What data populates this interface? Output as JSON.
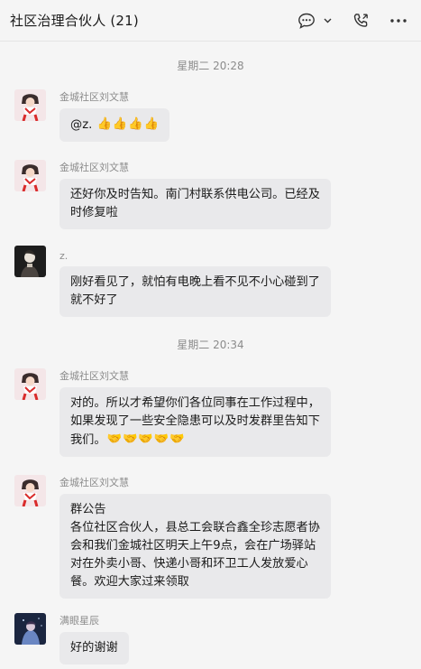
{
  "header": {
    "title": "社区治理合伙人 (21)",
    "icons": [
      "chat-bubble-icon",
      "chevron-down-icon",
      "phone-icon",
      "more-dots-icon"
    ]
  },
  "times": [
    "星期二 20:28",
    "星期二 20:34"
  ],
  "messages": [
    {
      "sender": "金城社区刘文慧",
      "lines": [
        "@z. "
      ],
      "emoji": [
        "👍",
        "👍",
        "👍",
        "👍"
      ]
    },
    {
      "sender": "金城社区刘文慧",
      "lines": [
        "还好你及时告知。南门村联系供电公司。已经及",
        "时修复啦"
      ]
    },
    {
      "sender": "z.",
      "lines": [
        "刚好看见了，就怕有电晚上看不见不小心碰到了",
        "就不好了"
      ]
    },
    {
      "sender": "金城社区刘文慧",
      "lines": [
        "对的。所以才希望你们各位同事在工作过程中，",
        "如果发现了一些安全隐患可以及时发群里告知下",
        "我们。"
      ],
      "emoji": [
        "🤝",
        "🤝",
        "🤝",
        "🤝",
        "🤝"
      ]
    },
    {
      "sender": "金城社区刘文慧",
      "lines": [
        "群公告",
        "各位社区合伙人，县总工会联合鑫全珍志愿者协",
        "会和我们金城社区明天上午9点，会在广场驿站",
        "对在外卖小哥、快递小哥和环卫工人发放爱心",
        "餐。欢迎大家过来领取"
      ]
    },
    {
      "sender": "满眼星辰",
      "lines": [
        "好的谢谢"
      ]
    }
  ],
  "colors": {
    "background": "#f5f5f5",
    "bubble": "#e9e9eb",
    "meta_text": "#8c8c8c"
  }
}
